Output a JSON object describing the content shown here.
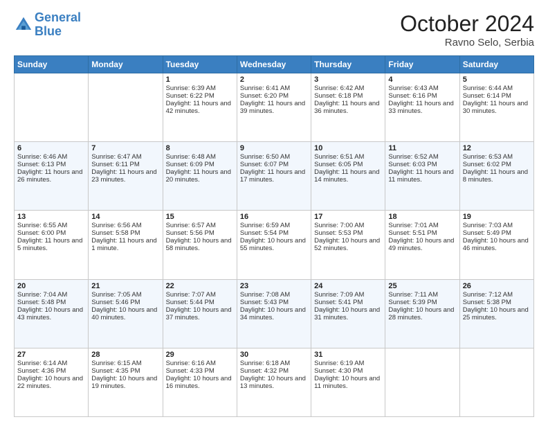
{
  "header": {
    "logo_line1": "General",
    "logo_line2": "Blue",
    "month_title": "October 2024",
    "location": "Ravno Selo, Serbia"
  },
  "days_of_week": [
    "Sunday",
    "Monday",
    "Tuesday",
    "Wednesday",
    "Thursday",
    "Friday",
    "Saturday"
  ],
  "weeks": [
    [
      {
        "day": "",
        "sunrise": "",
        "sunset": "",
        "daylight": ""
      },
      {
        "day": "",
        "sunrise": "",
        "sunset": "",
        "daylight": ""
      },
      {
        "day": "1",
        "sunrise": "Sunrise: 6:39 AM",
        "sunset": "Sunset: 6:22 PM",
        "daylight": "Daylight: 11 hours and 42 minutes."
      },
      {
        "day": "2",
        "sunrise": "Sunrise: 6:41 AM",
        "sunset": "Sunset: 6:20 PM",
        "daylight": "Daylight: 11 hours and 39 minutes."
      },
      {
        "day": "3",
        "sunrise": "Sunrise: 6:42 AM",
        "sunset": "Sunset: 6:18 PM",
        "daylight": "Daylight: 11 hours and 36 minutes."
      },
      {
        "day": "4",
        "sunrise": "Sunrise: 6:43 AM",
        "sunset": "Sunset: 6:16 PM",
        "daylight": "Daylight: 11 hours and 33 minutes."
      },
      {
        "day": "5",
        "sunrise": "Sunrise: 6:44 AM",
        "sunset": "Sunset: 6:14 PM",
        "daylight": "Daylight: 11 hours and 30 minutes."
      }
    ],
    [
      {
        "day": "6",
        "sunrise": "Sunrise: 6:46 AM",
        "sunset": "Sunset: 6:13 PM",
        "daylight": "Daylight: 11 hours and 26 minutes."
      },
      {
        "day": "7",
        "sunrise": "Sunrise: 6:47 AM",
        "sunset": "Sunset: 6:11 PM",
        "daylight": "Daylight: 11 hours and 23 minutes."
      },
      {
        "day": "8",
        "sunrise": "Sunrise: 6:48 AM",
        "sunset": "Sunset: 6:09 PM",
        "daylight": "Daylight: 11 hours and 20 minutes."
      },
      {
        "day": "9",
        "sunrise": "Sunrise: 6:50 AM",
        "sunset": "Sunset: 6:07 PM",
        "daylight": "Daylight: 11 hours and 17 minutes."
      },
      {
        "day": "10",
        "sunrise": "Sunrise: 6:51 AM",
        "sunset": "Sunset: 6:05 PM",
        "daylight": "Daylight: 11 hours and 14 minutes."
      },
      {
        "day": "11",
        "sunrise": "Sunrise: 6:52 AM",
        "sunset": "Sunset: 6:03 PM",
        "daylight": "Daylight: 11 hours and 11 minutes."
      },
      {
        "day": "12",
        "sunrise": "Sunrise: 6:53 AM",
        "sunset": "Sunset: 6:02 PM",
        "daylight": "Daylight: 11 hours and 8 minutes."
      }
    ],
    [
      {
        "day": "13",
        "sunrise": "Sunrise: 6:55 AM",
        "sunset": "Sunset: 6:00 PM",
        "daylight": "Daylight: 11 hours and 5 minutes."
      },
      {
        "day": "14",
        "sunrise": "Sunrise: 6:56 AM",
        "sunset": "Sunset: 5:58 PM",
        "daylight": "Daylight: 11 hours and 1 minute."
      },
      {
        "day": "15",
        "sunrise": "Sunrise: 6:57 AM",
        "sunset": "Sunset: 5:56 PM",
        "daylight": "Daylight: 10 hours and 58 minutes."
      },
      {
        "day": "16",
        "sunrise": "Sunrise: 6:59 AM",
        "sunset": "Sunset: 5:54 PM",
        "daylight": "Daylight: 10 hours and 55 minutes."
      },
      {
        "day": "17",
        "sunrise": "Sunrise: 7:00 AM",
        "sunset": "Sunset: 5:53 PM",
        "daylight": "Daylight: 10 hours and 52 minutes."
      },
      {
        "day": "18",
        "sunrise": "Sunrise: 7:01 AM",
        "sunset": "Sunset: 5:51 PM",
        "daylight": "Daylight: 10 hours and 49 minutes."
      },
      {
        "day": "19",
        "sunrise": "Sunrise: 7:03 AM",
        "sunset": "Sunset: 5:49 PM",
        "daylight": "Daylight: 10 hours and 46 minutes."
      }
    ],
    [
      {
        "day": "20",
        "sunrise": "Sunrise: 7:04 AM",
        "sunset": "Sunset: 5:48 PM",
        "daylight": "Daylight: 10 hours and 43 minutes."
      },
      {
        "day": "21",
        "sunrise": "Sunrise: 7:05 AM",
        "sunset": "Sunset: 5:46 PM",
        "daylight": "Daylight: 10 hours and 40 minutes."
      },
      {
        "day": "22",
        "sunrise": "Sunrise: 7:07 AM",
        "sunset": "Sunset: 5:44 PM",
        "daylight": "Daylight: 10 hours and 37 minutes."
      },
      {
        "day": "23",
        "sunrise": "Sunrise: 7:08 AM",
        "sunset": "Sunset: 5:43 PM",
        "daylight": "Daylight: 10 hours and 34 minutes."
      },
      {
        "day": "24",
        "sunrise": "Sunrise: 7:09 AM",
        "sunset": "Sunset: 5:41 PM",
        "daylight": "Daylight: 10 hours and 31 minutes."
      },
      {
        "day": "25",
        "sunrise": "Sunrise: 7:11 AM",
        "sunset": "Sunset: 5:39 PM",
        "daylight": "Daylight: 10 hours and 28 minutes."
      },
      {
        "day": "26",
        "sunrise": "Sunrise: 7:12 AM",
        "sunset": "Sunset: 5:38 PM",
        "daylight": "Daylight: 10 hours and 25 minutes."
      }
    ],
    [
      {
        "day": "27",
        "sunrise": "Sunrise: 6:14 AM",
        "sunset": "Sunset: 4:36 PM",
        "daylight": "Daylight: 10 hours and 22 minutes."
      },
      {
        "day": "28",
        "sunrise": "Sunrise: 6:15 AM",
        "sunset": "Sunset: 4:35 PM",
        "daylight": "Daylight: 10 hours and 19 minutes."
      },
      {
        "day": "29",
        "sunrise": "Sunrise: 6:16 AM",
        "sunset": "Sunset: 4:33 PM",
        "daylight": "Daylight: 10 hours and 16 minutes."
      },
      {
        "day": "30",
        "sunrise": "Sunrise: 6:18 AM",
        "sunset": "Sunset: 4:32 PM",
        "daylight": "Daylight: 10 hours and 13 minutes."
      },
      {
        "day": "31",
        "sunrise": "Sunrise: 6:19 AM",
        "sunset": "Sunset: 4:30 PM",
        "daylight": "Daylight: 10 hours and 11 minutes."
      },
      {
        "day": "",
        "sunrise": "",
        "sunset": "",
        "daylight": ""
      },
      {
        "day": "",
        "sunrise": "",
        "sunset": "",
        "daylight": ""
      }
    ]
  ]
}
